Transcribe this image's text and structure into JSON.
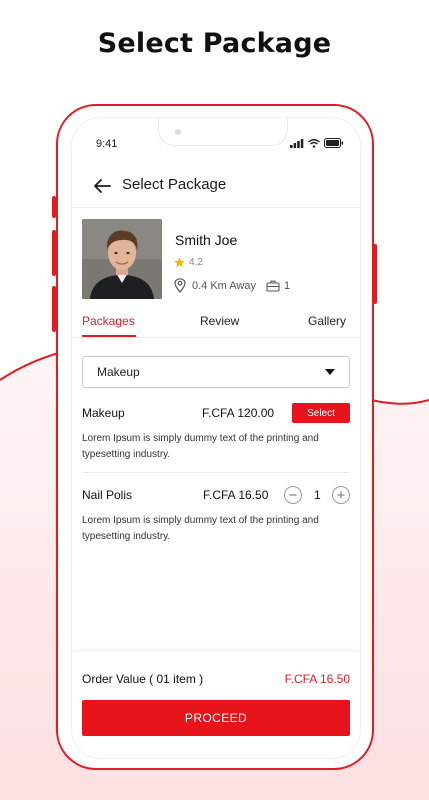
{
  "headline": "Select Package",
  "status_bar": {
    "time": "9:41"
  },
  "appbar": {
    "title": "Select Package",
    "back_icon": "arrow-left-icon"
  },
  "profile": {
    "name": "Smith Joe",
    "rating": "4.2",
    "distance": "0.4 Km Away",
    "count": "1"
  },
  "tabs": [
    {
      "label": "Packages",
      "active": true
    },
    {
      "label": "Review",
      "active": false
    },
    {
      "label": "Gallery",
      "active": false
    }
  ],
  "dropdown": {
    "selected": "Makeup"
  },
  "packages": [
    {
      "name": "Makeup",
      "price": "F.CFA 120.00",
      "action_label": "Select",
      "description": "Lorem Ipsum is simply dummy text of the printing and typesetting industry."
    },
    {
      "name": "Nail Polis",
      "price": "F.CFA 16.50",
      "quantity": "1",
      "description": "Lorem Ipsum is simply dummy text of the printing and typesetting industry."
    }
  ],
  "footer": {
    "order_label": "Order Value ( 01 item )",
    "order_value": "F.CFA 16.50",
    "proceed_label": "PROCEED"
  },
  "colors": {
    "accent": "#e8141c",
    "background_tint": "#fde9ea"
  }
}
